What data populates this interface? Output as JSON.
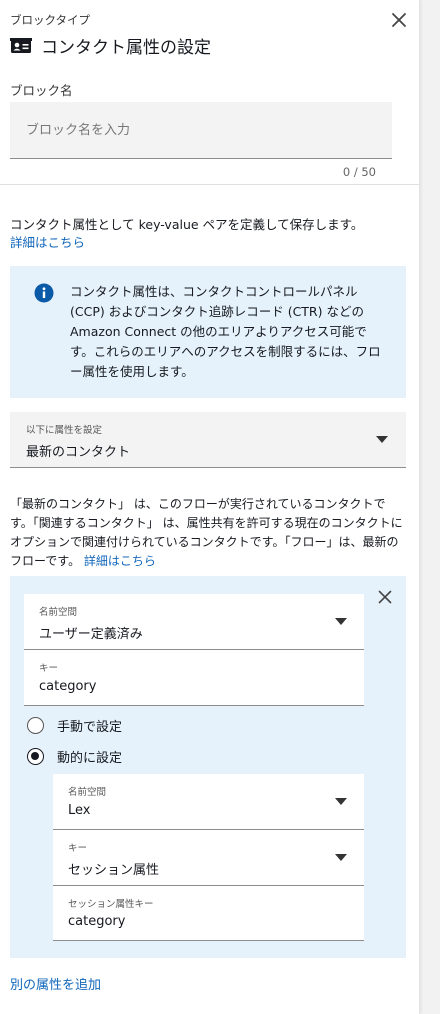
{
  "header": {
    "subtitle": "ブロックタイプ",
    "title": "コンタクト属性の設定",
    "block_icon": "contact-card-icon",
    "close_icon": "close-icon"
  },
  "block_name": {
    "label": "ブロック名",
    "placeholder": "ブロック名を入力",
    "value": "",
    "counter": "0 / 50"
  },
  "description": {
    "text": "コンタクト属性として key-value ペアを定義して保存します。",
    "link": "詳細はこちら"
  },
  "info": {
    "icon": "info-icon",
    "text": "コンタクト属性は、コンタクトコントロールパネル (CCP) およびコンタクト追跡レコード (CTR) などの Amazon Connect の他のエリアよりアクセス可能です。これらのエリアへのアクセスを制限するには、フロー属性を使用します。"
  },
  "set_attributes_on": {
    "label": "以下に属性を設定",
    "value": "最新のコンタクト"
  },
  "explanation": {
    "text": "「最新のコンタクト」 は、このフローが実行されているコンタクトです。「関連するコンタクト」 は、属性共有を許可する現在のコンタクトにオプションで関連付けられているコンタクトです。「フロー」は、最新のフローです。",
    "link": "詳細はこちら"
  },
  "attribute": {
    "namespace": {
      "label": "名前空間",
      "value": "ユーザー定義済み"
    },
    "key": {
      "label": "キー",
      "value": "category"
    },
    "options": {
      "manual": "手動で設定",
      "dynamic": "動的に設定",
      "selected": "dynamic"
    },
    "dynamic": {
      "namespace": {
        "label": "名前空間",
        "value": "Lex"
      },
      "key": {
        "label": "キー",
        "value": "セッション属性"
      },
      "session_key": {
        "label": "セッション属性キー",
        "value": "category"
      }
    }
  },
  "add_attribute": "別の属性を追加",
  "colors": {
    "accent_link": "#1166bb",
    "info_bg": "#e6f2fb",
    "field_bg": "#f3f3f3",
    "info_icon": "#0b5aa8"
  }
}
